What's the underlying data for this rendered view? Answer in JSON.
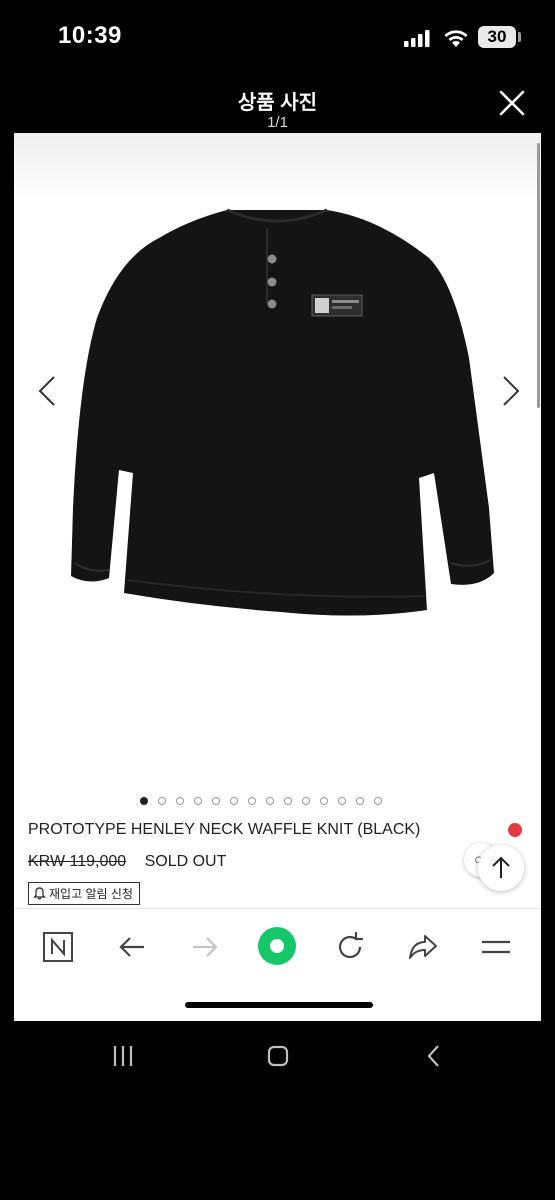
{
  "status": {
    "time": "10:39",
    "battery": "30"
  },
  "viewer": {
    "title": "상품 사진",
    "counter": "1/1"
  },
  "icons": {
    "close": "close-icon",
    "prev": "chevron-left-icon",
    "next": "chevron-right-icon",
    "scroll_top": "arrow-up-icon",
    "bell": "bell-icon"
  },
  "product": {
    "name": "PROTOTYPE HENLEY NECK WAFFLE KNIT (BLACK)",
    "price": "KRW 119,000",
    "status": "SOLD OUT",
    "restock_label": "재입고 알림 신청",
    "image_count": 14,
    "active_image": 1,
    "cs_label": "CS"
  },
  "toolbar": {
    "items": [
      "naver-logo-icon",
      "back-arrow-icon",
      "forward-arrow-icon",
      "green-ring-icon",
      "refresh-icon",
      "share-icon",
      "menu-icon"
    ]
  },
  "colors": {
    "accent_green": "#16c76a",
    "alert_red": "#e23b45"
  }
}
